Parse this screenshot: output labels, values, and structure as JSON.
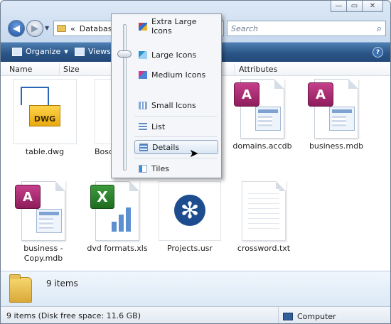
{
  "address": {
    "prefix": "«",
    "path": "Database"
  },
  "search": {
    "placeholder": "Search"
  },
  "toolbar": {
    "organize_label": "Organize",
    "views_label": "Views"
  },
  "columns": [
    "Name",
    "Size",
    "Attributes"
  ],
  "view_menu": {
    "items": [
      {
        "label": "Extra Large Icons"
      },
      {
        "label": "Large Icons"
      },
      {
        "label": "Medium Icons"
      },
      {
        "label": "Small Icons"
      },
      {
        "label": "List"
      },
      {
        "label": "Details"
      },
      {
        "label": "Tiles"
      }
    ],
    "selected": "Details"
  },
  "files": [
    {
      "label": "table.dwg",
      "badge": "DWG"
    },
    {
      "label": "Bosc"
    },
    {
      "label": "domains.accdb"
    },
    {
      "label": "business.mdb"
    },
    {
      "label": "business - Copy.mdb"
    },
    {
      "label": "dvd formats.xls",
      "badge": "X"
    },
    {
      "label": "Projects.usr"
    },
    {
      "label": "crossword.txt"
    }
  ],
  "details_pane": {
    "item_count": "9 items"
  },
  "status": {
    "left": "9 items (Disk free space: 11.6 GB)",
    "zone": "Computer"
  }
}
